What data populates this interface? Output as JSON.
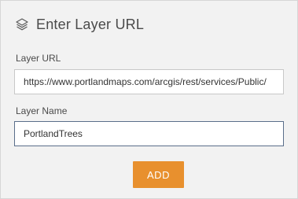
{
  "header": {
    "title": "Enter Layer URL",
    "icon": "layers-icon"
  },
  "url_field": {
    "label": "Layer URL",
    "value": "https://www.portlandmaps.com/arcgis/rest/services/Public/"
  },
  "name_field": {
    "label": "Layer Name",
    "value": "PortlandTrees"
  },
  "add_button": {
    "label": "ADD",
    "color": "#e8902e"
  }
}
